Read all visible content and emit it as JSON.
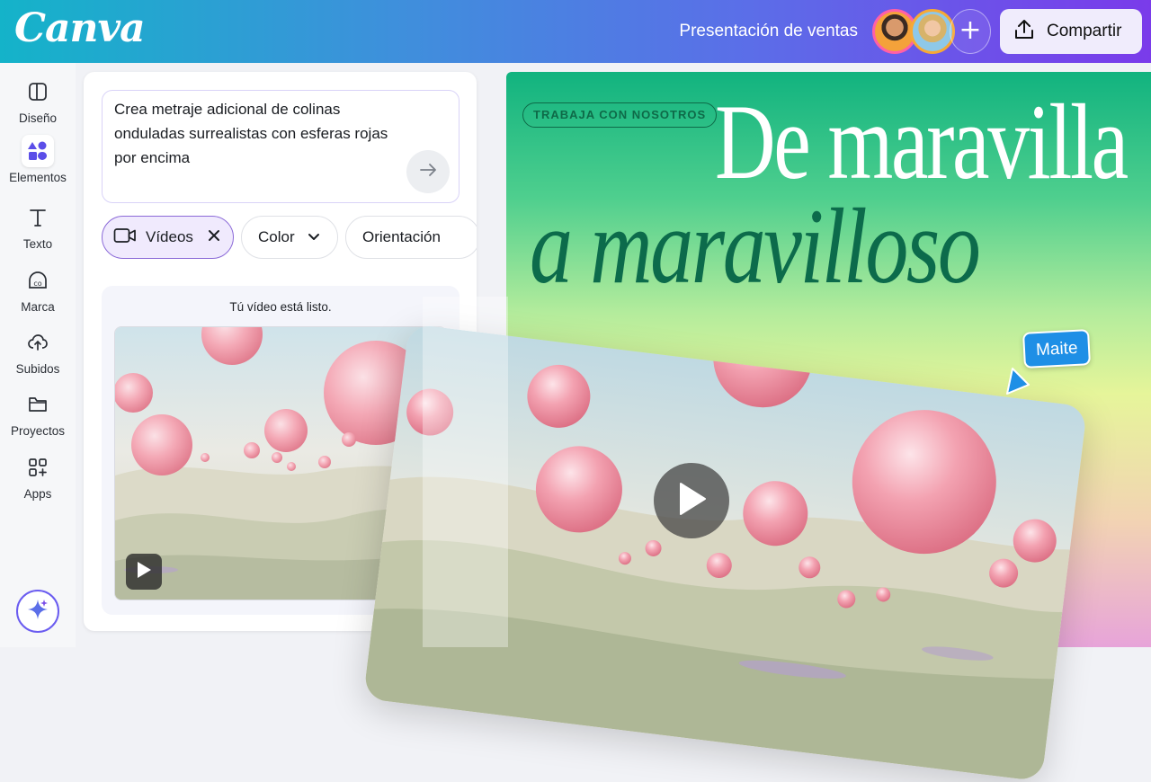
{
  "header": {
    "logo": "Canva",
    "doc_title": "Presentación de ventas",
    "add_label": "+",
    "share_label": "Compartir"
  },
  "rail": {
    "items": [
      {
        "label": "Diseño",
        "icon": "layout-icon"
      },
      {
        "label": "Elementos",
        "icon": "shapes-icon",
        "active": true
      },
      {
        "label": "Texto",
        "icon": "text-icon"
      },
      {
        "label": "Marca",
        "icon": "brand-icon"
      },
      {
        "label": "Subidos",
        "icon": "cloud-upload-icon"
      },
      {
        "label": "Proyectos",
        "icon": "folder-icon"
      },
      {
        "label": "Apps",
        "icon": "apps-icon"
      }
    ],
    "magic_icon": "sparkle-icon"
  },
  "panel": {
    "prompt": "Crea metraje adicional de colinas onduladas surrealistas con esferas rojas por encima",
    "chips": {
      "videos": "Vídeos",
      "color": "Color",
      "orientation": "Orientación"
    },
    "ready_text": "Tú vídeo está listo."
  },
  "canvas": {
    "badge": "TRABAJA CON NOSOTROS",
    "headline_line1": "De maravilla",
    "headline_line2": "a maravilloso",
    "collaborator": "Maite"
  },
  "colors": {
    "brand_gradient_start": "#14b3c9",
    "brand_gradient_end": "#7a3bea",
    "accent_purple": "#8b6ad8",
    "headline_green": "#0c6b4b",
    "cursor_blue": "#1e8fe6"
  }
}
